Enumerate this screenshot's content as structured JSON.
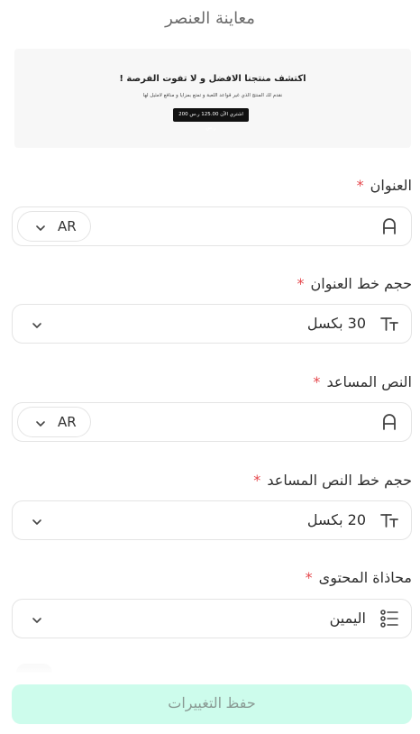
{
  "header": {
    "title": "معاينة العنصر"
  },
  "preview": {
    "title": "اكتشف منتجنا الافضل و لا تفوت الفرصة !",
    "subtitle": "نقدم لك المنتج الذي غير قواعد اللعبة و تمتع بمزايا و منافع لامثيل لها",
    "button": "اشتري الآن 125.00 ر.س 200 ر.س"
  },
  "form": {
    "title_field": {
      "label": "العنوان",
      "required": "*",
      "lang": "AR",
      "value": ""
    },
    "title_font_size": {
      "label": "حجم خط العنوان",
      "required": "*",
      "value": "30 بكسل"
    },
    "helper_text": {
      "label": "النص المساعد",
      "required": "*",
      "lang": "AR",
      "value": ""
    },
    "helper_font_size": {
      "label": "حجم خط النص المساعد",
      "required": "*",
      "value": "20 بكسل"
    },
    "content_align": {
      "label": "محاذاة المحتوى",
      "required": "*",
      "value": "اليمين"
    }
  },
  "actions": {
    "save_label": "حفظ التغييرات"
  },
  "colors": {
    "primary_light": "#cdfcec",
    "required": "#e5484d"
  },
  "icons": {
    "text_field": "letter-a-icon",
    "font_size": "text-size-icon",
    "alignment": "list-align-icon",
    "dropdown": "chevron-down-icon"
  }
}
